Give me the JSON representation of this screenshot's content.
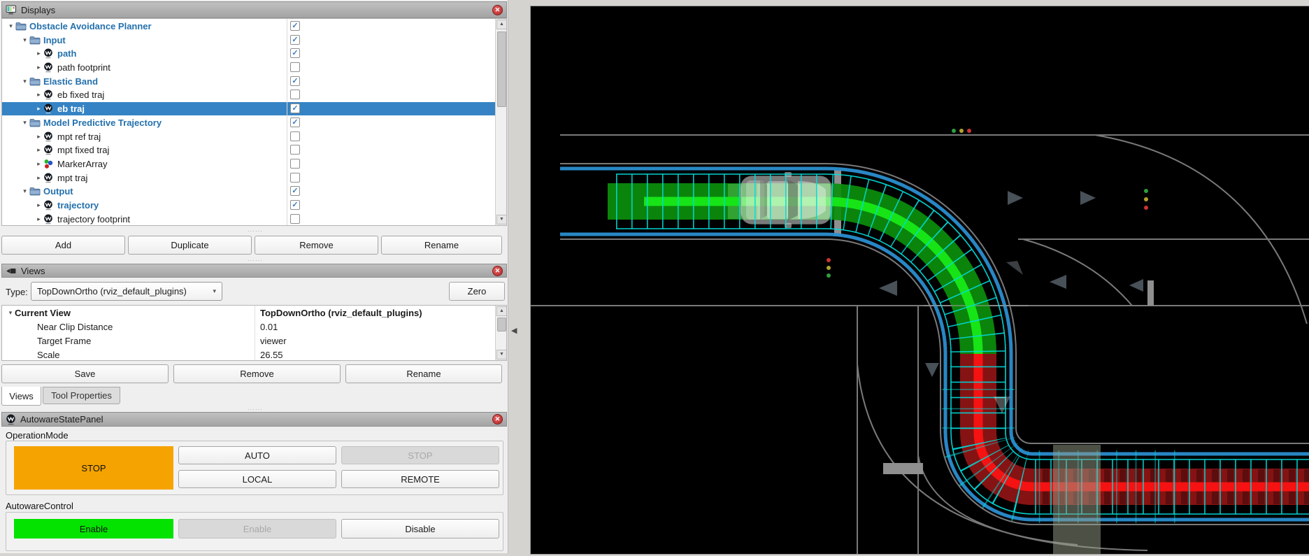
{
  "glyphs": {
    "check": "✓",
    "expanded": "▾",
    "collapsed": "▸",
    "combo_arrow": "▾",
    "up": "▲",
    "down": "▼",
    "close": "✕",
    "collapse_left": "◀",
    "dots": "······"
  },
  "displays": {
    "title": "Displays",
    "rows": [
      {
        "label": "Obstacle Avoidance Planner",
        "level": 0,
        "icon": "folder",
        "checked": true,
        "selected": false
      },
      {
        "label": "Input",
        "level": 1,
        "icon": "folder",
        "checked": true,
        "selected": false
      },
      {
        "label": "path",
        "level": 2,
        "icon": "autoware",
        "checked": true,
        "selected": false
      },
      {
        "label": "path footprint",
        "level": 2,
        "icon": "autoware",
        "checked": false,
        "selected": false
      },
      {
        "label": "Elastic Band",
        "level": 1,
        "icon": "folder",
        "checked": true,
        "selected": false
      },
      {
        "label": "eb fixed traj",
        "level": 2,
        "icon": "autoware",
        "checked": false,
        "selected": false
      },
      {
        "label": "eb traj",
        "level": 2,
        "icon": "autoware",
        "checked": true,
        "selected": true
      },
      {
        "label": "Model Predictive Trajectory",
        "level": 1,
        "icon": "folder",
        "checked": true,
        "selected": false
      },
      {
        "label": "mpt ref traj",
        "level": 2,
        "icon": "autoware",
        "checked": false,
        "selected": false
      },
      {
        "label": "mpt fixed traj",
        "level": 2,
        "icon": "autoware",
        "checked": false,
        "selected": false
      },
      {
        "label": "MarkerArray",
        "level": 2,
        "icon": "markers",
        "checked": false,
        "selected": false
      },
      {
        "label": "mpt traj",
        "level": 2,
        "icon": "autoware",
        "checked": false,
        "selected": false
      },
      {
        "label": "Output",
        "level": 1,
        "icon": "folder",
        "checked": true,
        "selected": false
      },
      {
        "label": "trajectory",
        "level": 2,
        "icon": "autoware",
        "checked": true,
        "selected": false
      },
      {
        "label": "trajectory footprint",
        "level": 2,
        "icon": "autoware",
        "checked": false,
        "selected": false
      }
    ],
    "buttons": {
      "add": "Add",
      "duplicate": "Duplicate",
      "remove": "Remove",
      "rename": "Rename"
    }
  },
  "views": {
    "title": "Views",
    "type_label": "Type:",
    "type_value": "TopDownOrtho (rviz_default_plugins)",
    "zero_button": "Zero",
    "properties": {
      "root_label": "Current View",
      "root_value": "TopDownOrtho (rviz_default_plugins)",
      "rows": [
        {
          "label": "Near Clip Distance",
          "value": "0.01"
        },
        {
          "label": "Target Frame",
          "value": "viewer"
        },
        {
          "label": "Scale",
          "value": "26.55"
        }
      ]
    },
    "buttons": {
      "save": "Save",
      "remove": "Remove",
      "rename": "Rename"
    },
    "tabs": [
      {
        "label": "Views",
        "active": true
      },
      {
        "label": "Tool Properties",
        "active": false
      }
    ]
  },
  "autoware_panel": {
    "title": "AutowareStatePanel",
    "operation_mode": {
      "label": "OperationMode",
      "current_state": "STOP",
      "auto_button": "AUTO",
      "stop_button": "STOP",
      "local_button": "LOCAL",
      "remote_button": "REMOTE",
      "disabled_buttons": [
        "STOP"
      ]
    },
    "autoware_control": {
      "label": "AutowareControl",
      "current_state": "Enable",
      "enable_button": "Enable",
      "disable_button": "Disable",
      "disabled_buttons": [
        "Enable"
      ]
    },
    "status_colors": {
      "operation_mode_active": "#f5a301",
      "control_enabled": "#04e200"
    }
  },
  "scene": {
    "description": "top-down RViz view of ego vehicle turning right through intersection",
    "colors": {
      "background": "#000000",
      "road": "#8f8f8f",
      "lane": "#2b8fd0",
      "green_band": "#0c8f0c",
      "green_line": "#17e417",
      "red_band": "#8d1414",
      "red_line": "#f51212",
      "cyan": "#00dcdc",
      "building": "#97a089"
    }
  }
}
